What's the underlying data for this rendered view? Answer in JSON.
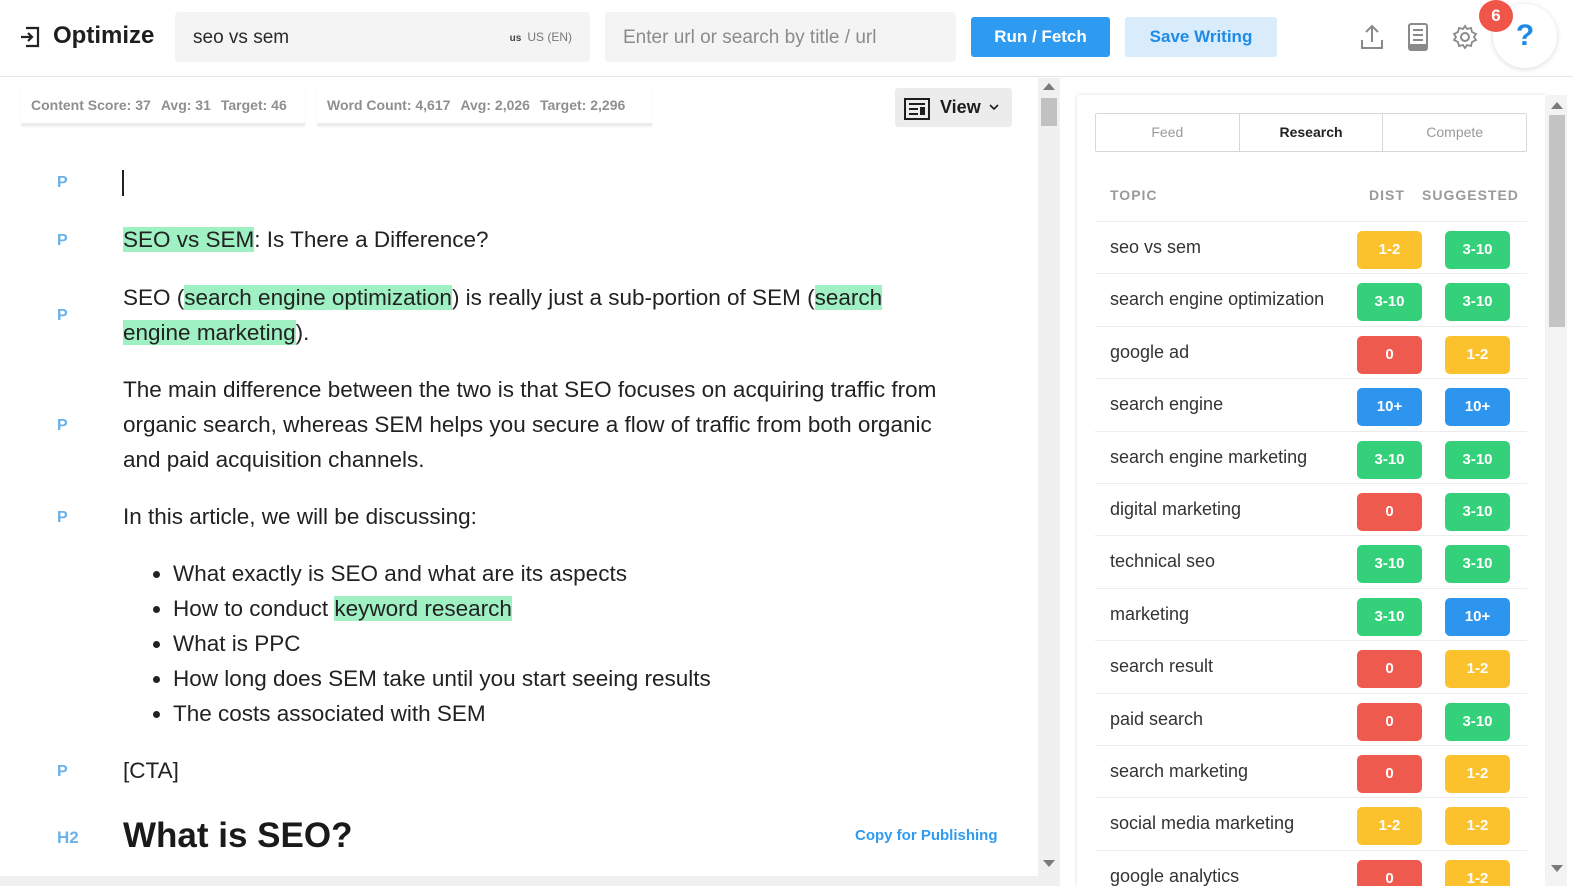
{
  "header": {
    "logo": "Optimize",
    "search_value": "seo vs sem",
    "locale_code": "us",
    "locale_label": "US (EN)",
    "url_placeholder": "Enter url or search by title / url",
    "run_label": "Run / Fetch",
    "save_label": "Save Writing",
    "notification_count": "6",
    "help_label": "?"
  },
  "metrics": {
    "content": {
      "label": "Content Score: 37",
      "avg": "Avg: 31",
      "target": "Target: 46"
    },
    "words": {
      "label": "Word Count: 4,617",
      "avg": "Avg: 2,026",
      "target": "Target: 2,296"
    }
  },
  "view_label": "View",
  "editor": {
    "tags": {
      "p": "P",
      "h2": "H2"
    },
    "title_line": {
      "hl": "SEO vs SEM",
      "rest": ": Is There a Difference?"
    },
    "para1": {
      "a": "SEO (",
      "hl1": "search engine optimization",
      "b": ") is really just a sub-portion of SEM (",
      "hl2a": "search",
      "hl2b": "engine marketing",
      "c": ")."
    },
    "para2": "The main difference between the two is that SEO focuses on acquiring traffic from organic search, whereas SEM helps you secure a flow of traffic from both organic and paid acquisition channels.",
    "para3": "In this article, we will be discussing:",
    "bullets": {
      "b1": "What exactly is SEO and what are its aspects",
      "b2a": "How to conduct ",
      "b2hl": "keyword research",
      "b3": "What is PPC",
      "b4": "How long does SEM take until you start seeing results",
      "b5": "The costs associated with SEM"
    },
    "cta": "[CTA]",
    "h2": "What is SEO?",
    "copy_publishing": "Copy for Publishing"
  },
  "panel": {
    "tabs": [
      "Feed",
      "Research",
      "Compete"
    ],
    "active_tab": "Research",
    "columns": {
      "topic": "TOPIC",
      "dist": "DIST",
      "suggested": "SUGGESTED"
    },
    "rows": [
      {
        "topic": "seo vs sem",
        "dist": "1-2",
        "dist_color": "yellow",
        "sugg": "3-10",
        "sugg_color": "green"
      },
      {
        "topic": "search engine optimization",
        "dist": "3-10",
        "dist_color": "green",
        "sugg": "3-10",
        "sugg_color": "green"
      },
      {
        "topic": "google ad",
        "dist": "0",
        "dist_color": "red",
        "sugg": "1-2",
        "sugg_color": "yellow"
      },
      {
        "topic": "search engine",
        "dist": "10+",
        "dist_color": "blue",
        "sugg": "10+",
        "sugg_color": "blue"
      },
      {
        "topic": "search engine marketing",
        "dist": "3-10",
        "dist_color": "green",
        "sugg": "3-10",
        "sugg_color": "green"
      },
      {
        "topic": "digital marketing",
        "dist": "0",
        "dist_color": "red",
        "sugg": "3-10",
        "sugg_color": "green"
      },
      {
        "topic": "technical seo",
        "dist": "3-10",
        "dist_color": "green",
        "sugg": "3-10",
        "sugg_color": "green"
      },
      {
        "topic": "marketing",
        "dist": "3-10",
        "dist_color": "green",
        "sugg": "10+",
        "sugg_color": "blue"
      },
      {
        "topic": "search result",
        "dist": "0",
        "dist_color": "red",
        "sugg": "1-2",
        "sugg_color": "yellow"
      },
      {
        "topic": "paid search",
        "dist": "0",
        "dist_color": "red",
        "sugg": "3-10",
        "sugg_color": "green"
      },
      {
        "topic": "search marketing",
        "dist": "0",
        "dist_color": "red",
        "sugg": "1-2",
        "sugg_color": "yellow"
      },
      {
        "topic": "social media marketing",
        "dist": "1-2",
        "dist_color": "yellow",
        "sugg": "1-2",
        "sugg_color": "yellow"
      },
      {
        "topic": "google analytics",
        "dist": "0",
        "dist_color": "red",
        "sugg": "1-2",
        "sugg_color": "yellow"
      }
    ]
  },
  "colors": {
    "accent": "#2e9bf0",
    "highlight": "#9ff0c3",
    "green": "#35d17a",
    "yellow": "#fbc22d",
    "red": "#ef5a4f",
    "blue": "#2e95ee"
  }
}
